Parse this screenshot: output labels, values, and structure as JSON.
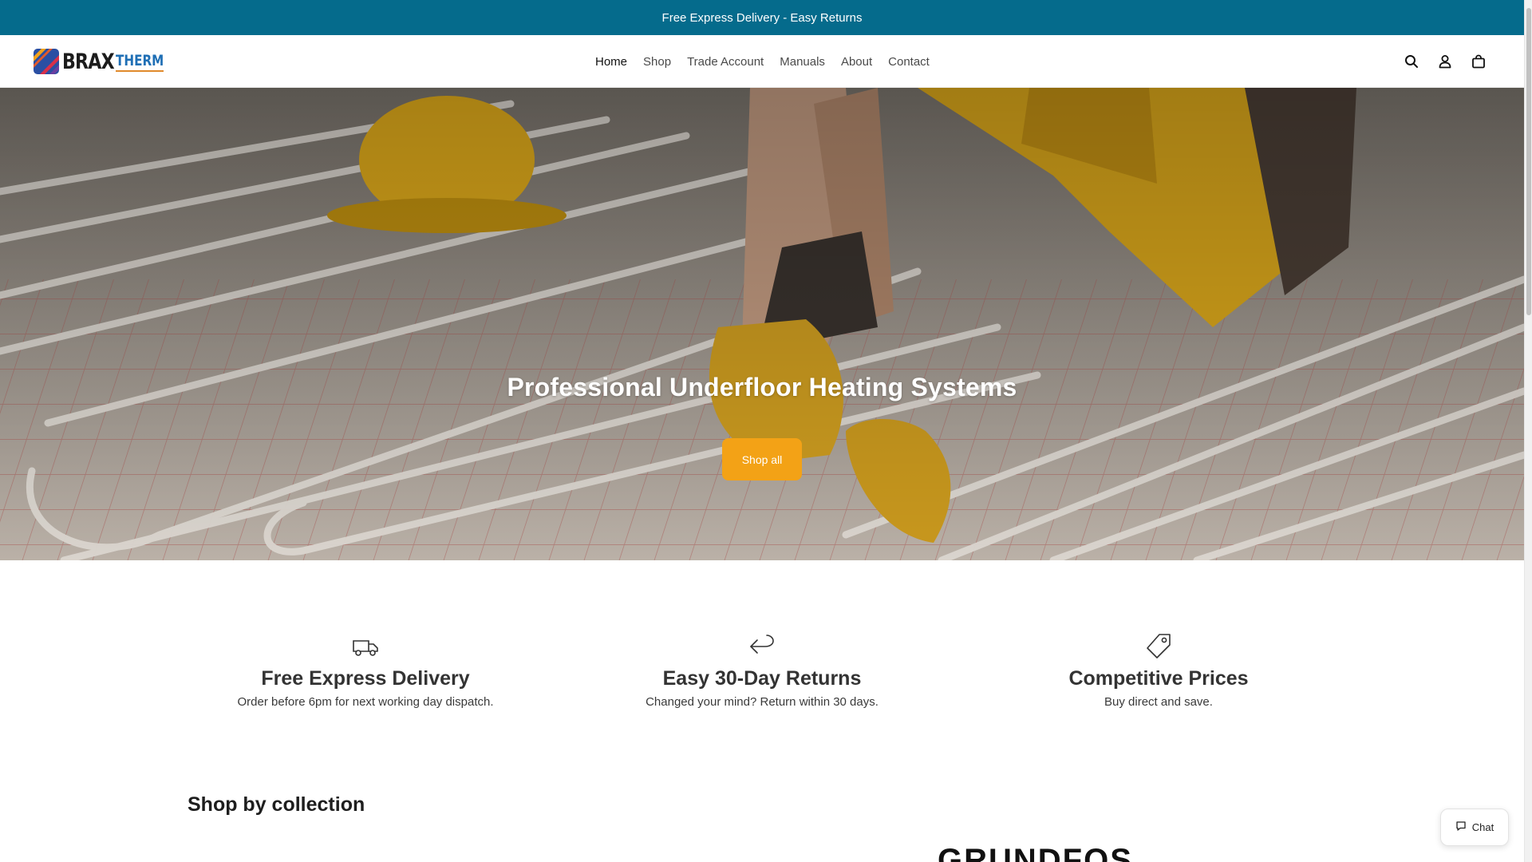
{
  "announcement": {
    "text": "Free Express Delivery - Easy Returns"
  },
  "brand": {
    "name_primary": "BRAX",
    "name_secondary": "THERM"
  },
  "nav": {
    "items": [
      {
        "label": "Home",
        "active": true
      },
      {
        "label": "Shop",
        "active": false
      },
      {
        "label": "Trade Account",
        "active": false
      },
      {
        "label": "Manuals",
        "active": false
      },
      {
        "label": "About",
        "active": false
      },
      {
        "label": "Contact",
        "active": false
      }
    ]
  },
  "header_icons": [
    "search-icon",
    "account-icon",
    "cart-icon"
  ],
  "hero": {
    "title": "Professional Underfloor Heating Systems",
    "button_label": "Shop all"
  },
  "features": [
    {
      "icon": "truck-icon",
      "title": "Free Express Delivery",
      "text": "Order before 6pm for next working day dispatch."
    },
    {
      "icon": "return-arrow-icon",
      "title": "Easy 30-Day Returns",
      "text": "Changed your mind? Return within 30 days."
    },
    {
      "icon": "price-tag-icon",
      "title": "Competitive Prices",
      "text": "Buy direct and save."
    }
  ],
  "collections": {
    "title": "Shop by collection",
    "brand_peek": "GRUNDFOS"
  },
  "chat": {
    "label": "Chat"
  },
  "colors": {
    "announcement_bg": "#056b8c",
    "accent": "#f3a216",
    "brand_blue": "#1f6fb5"
  }
}
